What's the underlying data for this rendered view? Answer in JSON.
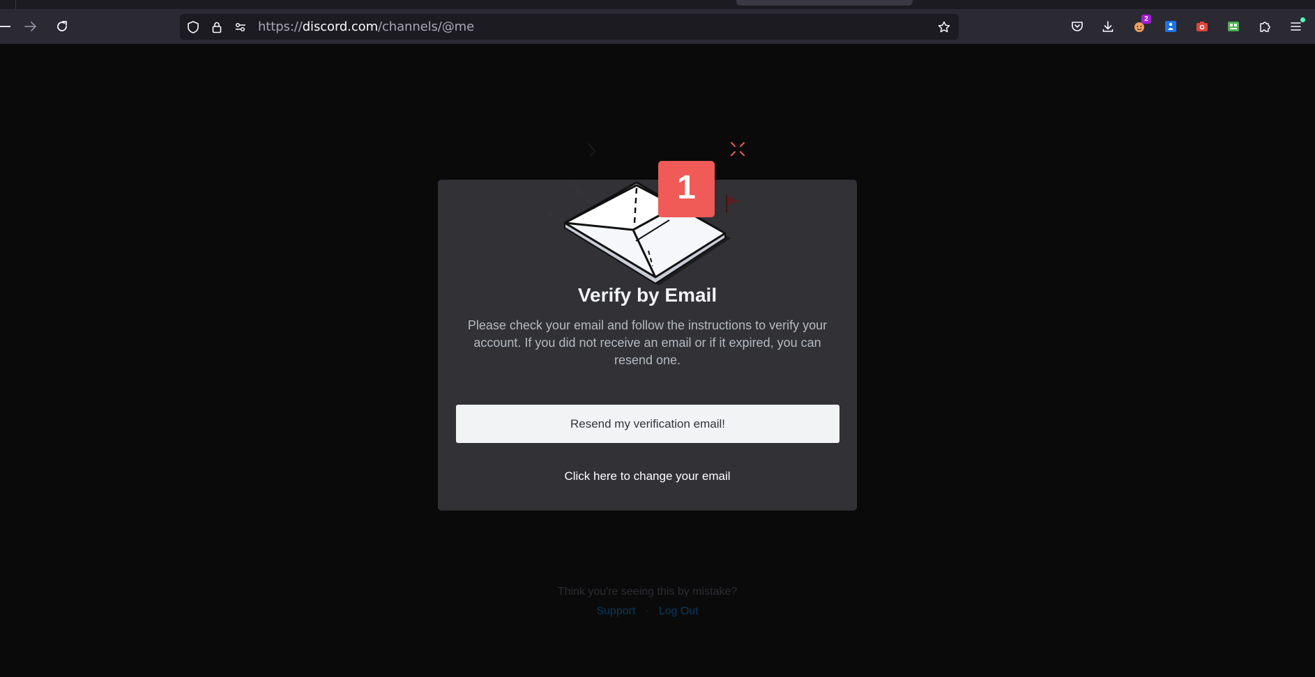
{
  "browser": {
    "url_prefix": "https://",
    "url_domain": "discord.com",
    "url_path": "/channels/@me",
    "extension_badge": "2"
  },
  "verify": {
    "badge_number": "1",
    "title": "Verify by Email",
    "description": "Please check your email and follow the instructions to verify your account. If you did not receive an email or if it expired, you can resend one.",
    "resend_button": "Resend my verification email!",
    "change_email_link": "Click here to change your email"
  },
  "footer": {
    "mistake_text": "Think you're seeing this by mistake?",
    "support_link": "Support",
    "separator": "·",
    "logout_link": "Log Out"
  },
  "colors": {
    "card_bg": "#313136",
    "page_bg": "#0a0a0b",
    "badge_red": "#f05a57",
    "button_bg": "#f2f3f5"
  }
}
